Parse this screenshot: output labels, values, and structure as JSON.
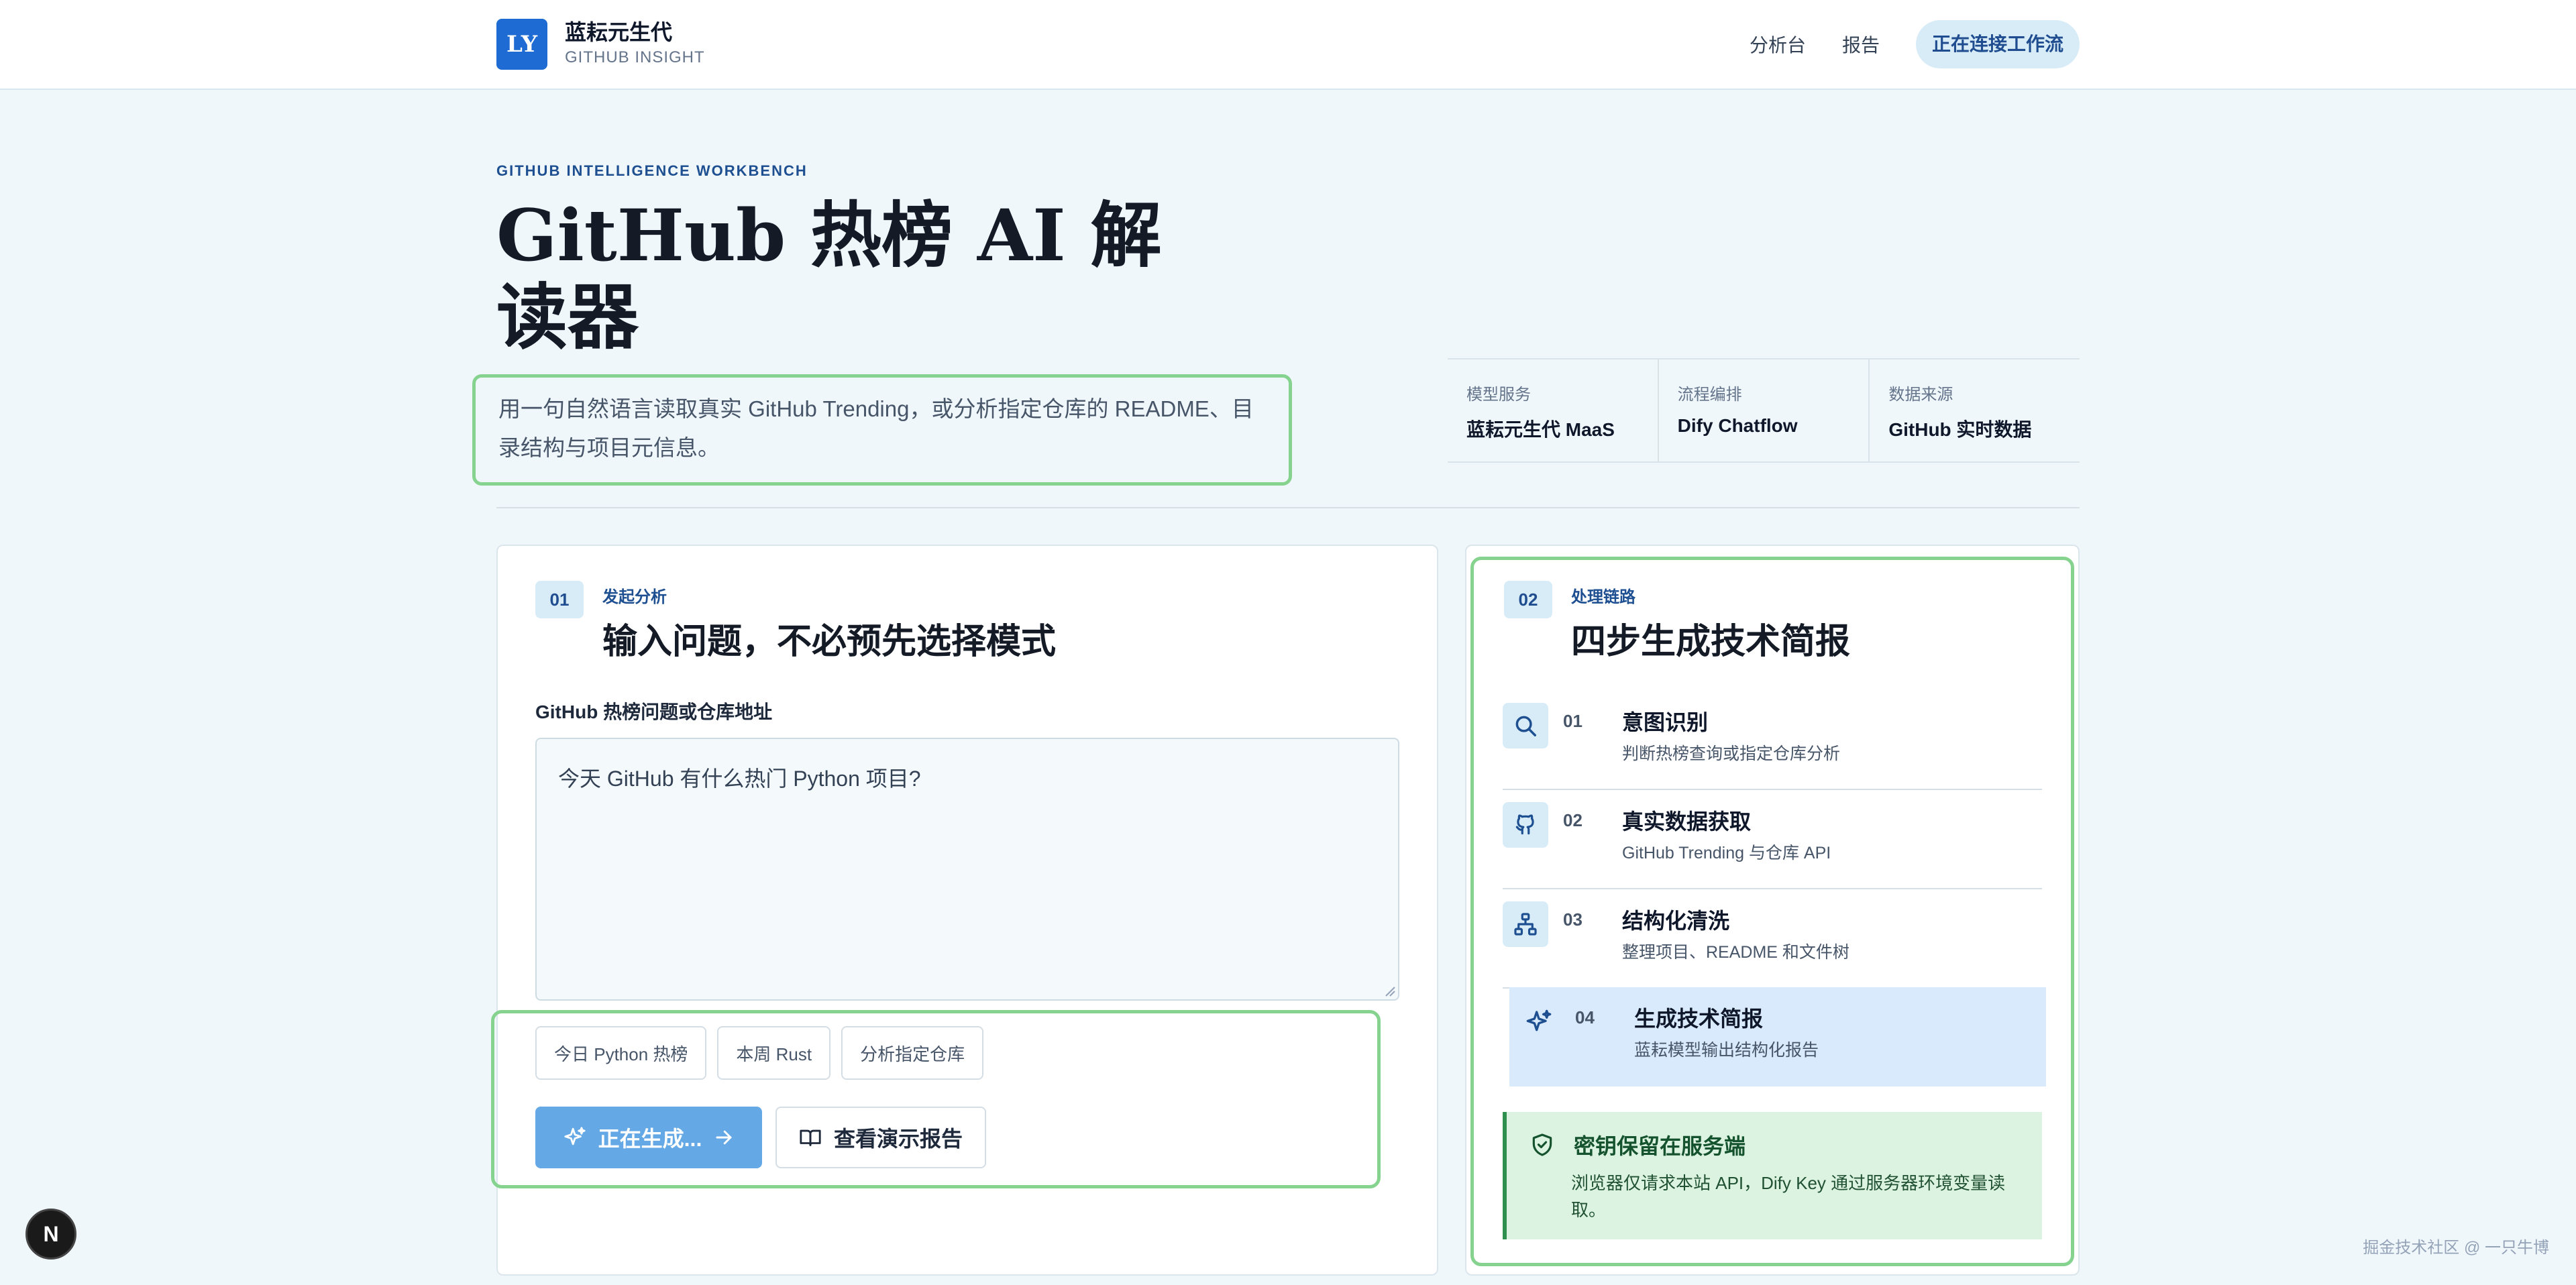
{
  "header": {
    "logo_text": "LY",
    "brand_name": "蓝耘元生代",
    "brand_sub": "GITHUB INSIGHT",
    "nav": [
      "分析台",
      "报告"
    ],
    "status_pill": "正在连接工作流"
  },
  "hero": {
    "kicker": "GITHUB INTELLIGENCE WORKBENCH",
    "title": "GitHub 热榜 AI 解读器",
    "description": "用一句自然语言读取真实 GitHub Trending，或分析指定仓库的 README、目录结构与项目元信息。"
  },
  "stats": [
    {
      "label": "模型服务",
      "value": "蓝耘元生代 MaaS"
    },
    {
      "label": "流程编排",
      "value": "Dify Chatflow"
    },
    {
      "label": "数据来源",
      "value": "GitHub 实时数据"
    }
  ],
  "analysis": {
    "step": "01",
    "kicker": "发起分析",
    "title": "输入问题，不必预先选择模式",
    "field_label": "GitHub 热榜问题或仓库地址",
    "input_value": "今天 GitHub 有什么热门 Python 项目?",
    "chips": [
      "今日 Python 热榜",
      "本周 Rust",
      "分析指定仓库"
    ],
    "primary_button": "正在生成...",
    "secondary_button": "查看演示报告"
  },
  "pipeline": {
    "step": "02",
    "kicker": "处理链路",
    "title": "四步生成技术简报",
    "items": [
      {
        "num": "01",
        "title": "意图识别",
        "desc": "判断热榜查询或指定仓库分析",
        "icon": "search-icon"
      },
      {
        "num": "02",
        "title": "真实数据获取",
        "desc": "GitHub Trending 与仓库 API",
        "icon": "github-icon"
      },
      {
        "num": "03",
        "title": "结构化清洗",
        "desc": "整理项目、README 和文件树",
        "icon": "hierarchy-icon"
      },
      {
        "num": "04",
        "title": "生成技术简报",
        "desc": "蓝耘模型输出结构化报告",
        "icon": "sparkle-icon"
      }
    ],
    "notice_title": "密钥保留在服务端",
    "notice_text": "浏览器仅请求本站 API，Dify Key 通过服务器环境变量读取。"
  },
  "misc": {
    "dev_badge": "N",
    "watermark": "掘金技术社区 @ 一只牛博"
  },
  "colors": {
    "accent": "#1d6bd3",
    "primary_button": "#64a8e6",
    "highlight_frame": "#86d38f",
    "notice_bg": "#dcf3e1"
  }
}
